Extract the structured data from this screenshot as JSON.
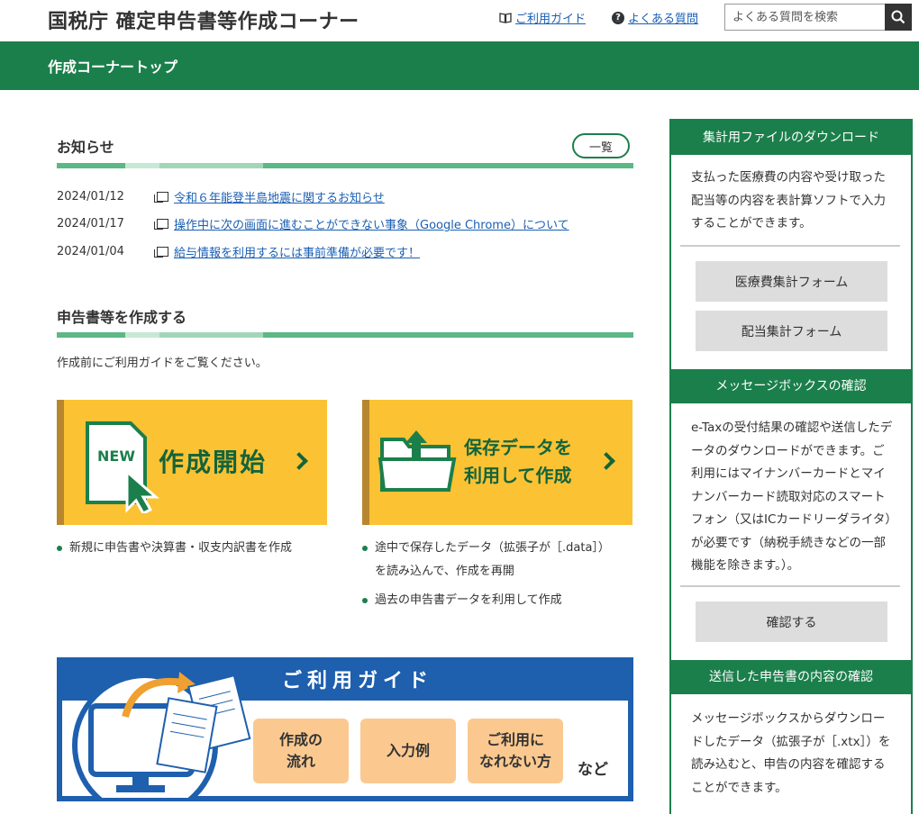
{
  "header": {
    "title": "国税庁 確定申告書等作成コーナー",
    "guide_link": "ご利用ガイド",
    "faq_link": "よくある質問",
    "search_placeholder": "よくある質問を検索"
  },
  "nav": {
    "title": "作成コーナートップ"
  },
  "news": {
    "title": "お知らせ",
    "list_button": "一覧",
    "items": [
      {
        "date": "2024/01/12",
        "text": "令和６年能登半島地震に関するお知らせ"
      },
      {
        "date": "2024/01/17",
        "text": "操作中に次の画面に進むことができない事象（Google Chrome）について"
      },
      {
        "date": "2024/01/04",
        "text": "給与情報を利用するには事前準備が必要です！"
      }
    ]
  },
  "create": {
    "title": "申告書等を作成する",
    "intro": "作成前にご利用ガイドをご覧ください。",
    "new_card": {
      "badge": "NEW",
      "label": "作成開始"
    },
    "saved_card": {
      "line1": "保存データを",
      "line2": "利用して作成"
    },
    "new_bullets": [
      "新規に申告書や決算書・収支内訳書を作成"
    ],
    "saved_bullets": [
      "途中で保存したデータ（拡張子が［.data］）",
      "を読み込んで、作成を再開",
      "過去の申告書データを利用して作成"
    ]
  },
  "guide": {
    "title": "ご利用ガイド",
    "pills": [
      "作成の\n流れ",
      "入力例",
      "ご利用に\nなれない方"
    ],
    "etc": "など"
  },
  "sidebar": {
    "download": {
      "title": "集計用ファイルのダウンロード",
      "text": "支払った医療費の内容や受け取った配当等の内容を表計算ソフトで入力することができます。",
      "buttons": [
        "医療費集計フォーム",
        "配当集計フォーム"
      ]
    },
    "messagebox": {
      "title": "メッセージボックスの確認",
      "text": "e-Taxの受付結果の確認や送信したデータのダウンロードができます。ご利用にはマイナンバーカードとマイナンバーカード読取対応のスマートフォン（又はICカードリーダライタ）が必要です（納税手続きなどの一部機能を除きます。）。",
      "button": "確認する"
    },
    "sent": {
      "title": "送信した申告書の内容の確認",
      "text": "メッセージボックスからダウンロードしたデータ（拡張子が［.xtx］）を読み込むと、申告の内容を確認することができます。"
    }
  },
  "colors": {
    "green": "#1b7f4b",
    "yellow": "#fbc234",
    "blue": "#1e5fae",
    "link": "#1a5fb4"
  }
}
